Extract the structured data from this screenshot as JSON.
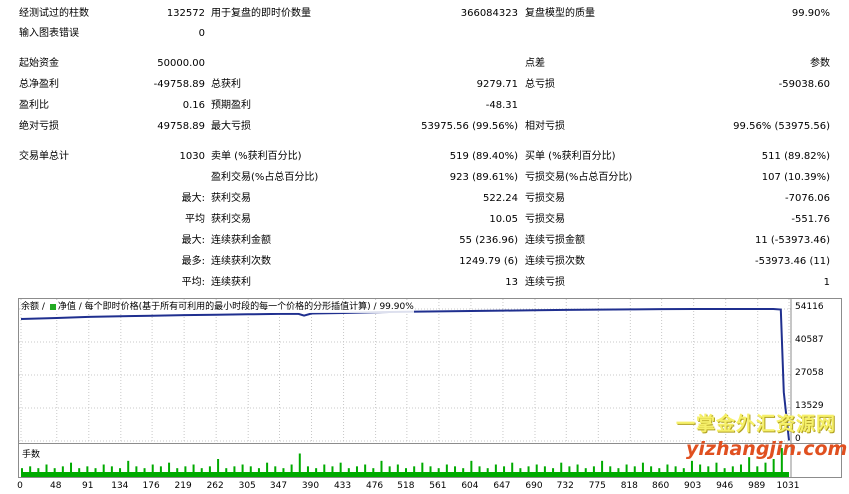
{
  "stats": {
    "bars_tested": {
      "label": "经测试过的柱数",
      "value": "132572"
    },
    "ticks_modelled": {
      "label": "用于复盘的即时价数量",
      "value": "366084323"
    },
    "modelling_quality": {
      "label": "复盘模型的质量",
      "value": "99.90%"
    },
    "mismatched_errors": {
      "label": "输入图表错误",
      "value": "0"
    },
    "initial_deposit": {
      "label": "起始资金",
      "value": "50000.00"
    },
    "spread": {
      "label": "点差",
      "value": "参数"
    },
    "net_profit": {
      "label": "总净盈利",
      "value": "-49758.89"
    },
    "gross_profit": {
      "label": "总获利",
      "value": "9279.71"
    },
    "gross_loss": {
      "label": "总亏损",
      "value": "-59038.60"
    },
    "profit_factor": {
      "label": "盈利比",
      "value": "0.16"
    },
    "expected_payoff": {
      "label": "预期盈利",
      "value": "-48.31"
    },
    "absolute_drawdown": {
      "label": "绝对亏损",
      "value": "49758.89"
    },
    "maximal_drawdown": {
      "label": "最大亏损",
      "value": "53975.56 (99.56%)"
    },
    "relative_drawdown": {
      "label": "相对亏损",
      "value": "99.56% (53975.56)"
    },
    "total_trades": {
      "label": "交易单总计",
      "value": "1030"
    },
    "short_positions": {
      "label": "卖单 (%获利百分比)",
      "value": "519 (89.40%)"
    },
    "long_positions": {
      "label": "买单 (%获利百分比)",
      "value": "511 (89.82%)"
    },
    "profit_trades": {
      "label": "盈利交易(%占总百分比)",
      "value": "923 (89.61%)"
    },
    "loss_trades": {
      "label": "亏损交易(%占总百分比)",
      "value": "107 (10.39%)"
    },
    "largest_profit": {
      "prefix": "最大:",
      "label": "获利交易",
      "value": "522.24"
    },
    "largest_loss": {
      "label": "亏损交易",
      "value": "-7076.06"
    },
    "average_profit": {
      "prefix": "平均",
      "label": "获利交易",
      "value": "10.05"
    },
    "average_loss": {
      "label": "亏损交易",
      "value": "-551.76"
    },
    "max_consec_wins": {
      "prefix": "最大:",
      "label": "连续获利金额",
      "value": "55 (236.96)"
    },
    "max_consec_losses": {
      "label": "连续亏损金额",
      "value": "11 (-53973.46)"
    },
    "max_consec_profit": {
      "prefix": "最多:",
      "label": "连续获利次数",
      "value": "1249.79 (6)"
    },
    "max_consec_loss": {
      "label": "连续亏损次数",
      "value": "-53973.46 (11)"
    },
    "avg_consec_wins": {
      "prefix": "平均:",
      "label": "连续获利",
      "value": "13"
    },
    "avg_consec_losses": {
      "label": "连续亏损",
      "value": "1"
    }
  },
  "chart": {
    "legend_balance": "余额",
    "legend_equity": "净值",
    "legend_text": "每个即时价格(基于所有可利用的最小时段的每一个价格的分形插值计算)",
    "legend_quality": "99.90%",
    "volume_label": "手数",
    "colors": {
      "balance": "#1f2f8f",
      "equity": "#22aa22",
      "volume": "#00aa00",
      "grid": "#c8c8c8"
    },
    "y_ticks": [
      "54116",
      "40587",
      "27058",
      "13529",
      "0"
    ],
    "x_ticks": [
      "0",
      "48",
      "91",
      "134",
      "176",
      "219",
      "262",
      "305",
      "347",
      "390",
      "433",
      "476",
      "518",
      "561",
      "604",
      "647",
      "690",
      "732",
      "775",
      "818",
      "860",
      "903",
      "946",
      "989",
      "1031"
    ]
  },
  "chart_data": {
    "type": "line",
    "x": [
      0,
      48,
      91,
      134,
      176,
      219,
      262,
      305,
      347,
      372,
      380,
      390,
      433,
      476,
      518,
      561,
      604,
      647,
      690,
      732,
      775,
      818,
      860,
      903,
      946,
      989,
      1010,
      1020,
      1024,
      1031
    ],
    "series": [
      {
        "name": "余额",
        "values": [
          50000,
          50450,
          50880,
          51150,
          51350,
          51600,
          51780,
          51950,
          52120,
          52150,
          51400,
          52250,
          52500,
          52800,
          53000,
          53150,
          53300,
          53450,
          53600,
          53750,
          53850,
          53950,
          54050,
          54100,
          54116,
          54100,
          54110,
          53900,
          20000,
          241
        ]
      }
    ],
    "ylim": [
      0,
      54116
    ],
    "xlim": [
      0,
      1031
    ],
    "volume": [
      1,
      2,
      1,
      3,
      1,
      2,
      4,
      1,
      2,
      1,
      3,
      2,
      1,
      5,
      2,
      1,
      3,
      2,
      4,
      1,
      2,
      3,
      1,
      2,
      6,
      1,
      2,
      3,
      2,
      1,
      4,
      2,
      1,
      3,
      9,
      2,
      1,
      3,
      2,
      4,
      1,
      2,
      3,
      1,
      5,
      2,
      3,
      1,
      2,
      4,
      2,
      1,
      3,
      2,
      1,
      5,
      2,
      1,
      3,
      2,
      4,
      1,
      2,
      3,
      2,
      1,
      4,
      2,
      3,
      1,
      2,
      5,
      2,
      1,
      3,
      2,
      4,
      2,
      1,
      3,
      2,
      1,
      5,
      3,
      2,
      4,
      1,
      2,
      3,
      7,
      2,
      4,
      6,
      12
    ]
  },
  "watermark": {
    "line1": "一掌金外汇资源网",
    "line2": "yizhangjin.com"
  }
}
